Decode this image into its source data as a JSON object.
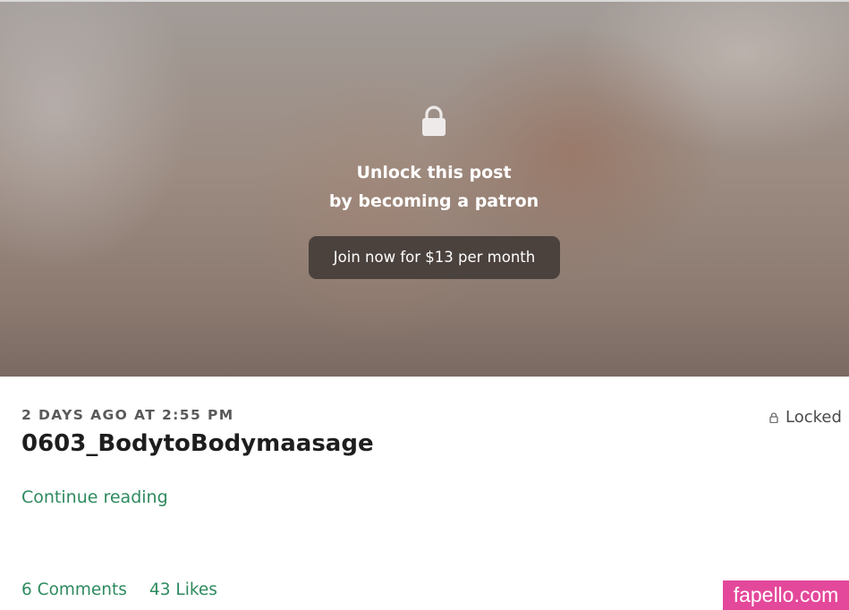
{
  "lock_overlay": {
    "icon": "lock-icon",
    "line1": "Unlock this post",
    "line2": "by becoming a patron",
    "join_button": "Join now for $13 per month"
  },
  "post": {
    "date": "2 DAYS AGO AT 2:55 PM",
    "status_icon": "lock-icon",
    "status": "Locked",
    "title": "0603_BodytoBodymaasage",
    "continue_link": "Continue reading",
    "comments": "6 Comments",
    "likes": "43 Likes"
  },
  "watermark": "fapello.com",
  "colors": {
    "accent_green": "#2e8a5e",
    "button_bg": "#4b423e",
    "watermark_bg": "#e4489a"
  }
}
